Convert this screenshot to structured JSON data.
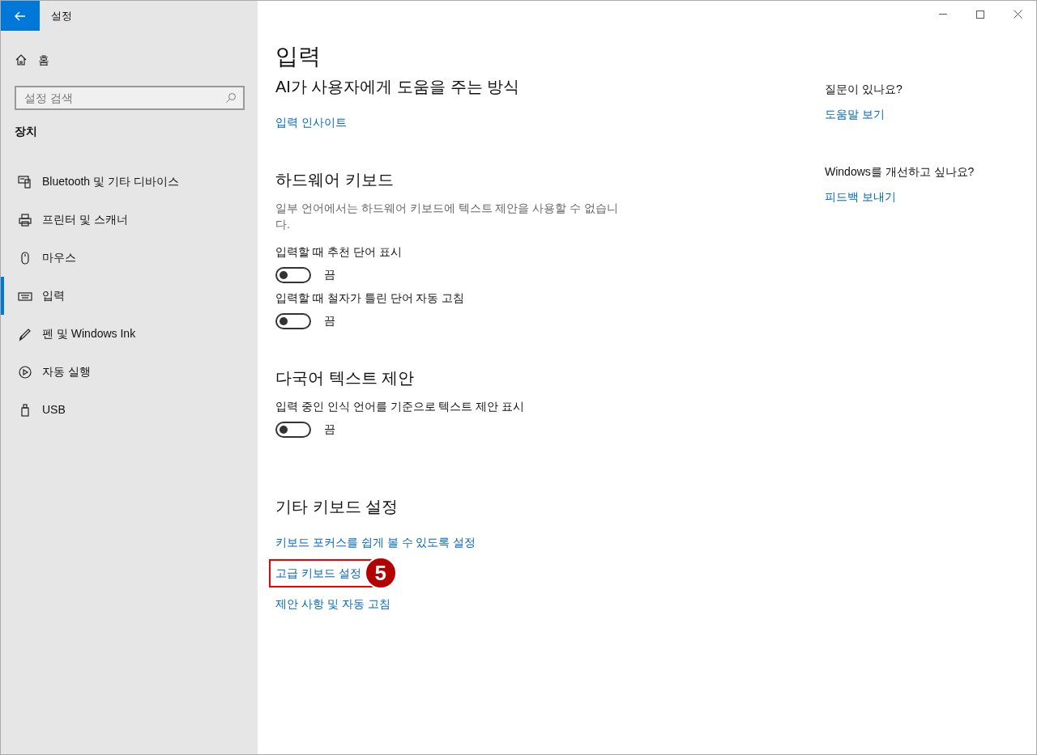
{
  "window": {
    "title": "설정"
  },
  "sidebar": {
    "home": "홈",
    "search": {
      "placeholder": "설정 검색"
    },
    "group": "장치",
    "items": [
      {
        "label": "Bluetooth 및 기타 디바이스",
        "selected": false
      },
      {
        "label": "프린터 및 스캐너",
        "selected": false
      },
      {
        "label": "마우스",
        "selected": false
      },
      {
        "label": "입력",
        "selected": true
      },
      {
        "label": "펜 및 Windows Ink",
        "selected": false
      },
      {
        "label": "자동 실행",
        "selected": false
      },
      {
        "label": "USB",
        "selected": false
      }
    ]
  },
  "page_title": "입력",
  "sections": [
    {
      "heading": "AI가 사용자에게 도움을 주는 방식",
      "items": [
        {
          "kind": "link",
          "label": "입력 인사이트",
          "highlighted": false
        }
      ]
    },
    {
      "heading": "하드웨어 키보드",
      "description": "일부 언어에서는 하드웨어 키보드에 텍스트 제안을 사용할 수 없습니다.",
      "items": [
        {
          "kind": "toggle",
          "label": "입력할 때 추천 단어 표시",
          "on": false,
          "state_label": "끔"
        },
        {
          "kind": "toggle",
          "label": "입력할 때 철자가 틀린 단어 자동 고침",
          "on": false,
          "state_label": "끔"
        }
      ]
    },
    {
      "heading": "다국어 텍스트 제안",
      "items": [
        {
          "kind": "toggle",
          "label": "입력 중인 인식 언어를 기준으로 텍스트 제안 표시",
          "on": false,
          "state_label": "끔"
        }
      ]
    },
    {
      "heading": "기타 키보드 설정",
      "items": [
        {
          "kind": "link",
          "label": "키보드 포커스를 쉽게 볼 수 있도록 설정",
          "highlighted": false
        },
        {
          "kind": "link",
          "label": "고급 키보드 설정",
          "highlighted": true,
          "badge": "5"
        },
        {
          "kind": "link",
          "label": "제안 사항 및 자동 고침",
          "highlighted": false
        }
      ]
    }
  ],
  "help": [
    {
      "question": "질문이 있나요?",
      "link": "도움말 보기"
    },
    {
      "question": "Windows를 개선하고 싶나요?",
      "link": "피드백 보내기"
    }
  ]
}
